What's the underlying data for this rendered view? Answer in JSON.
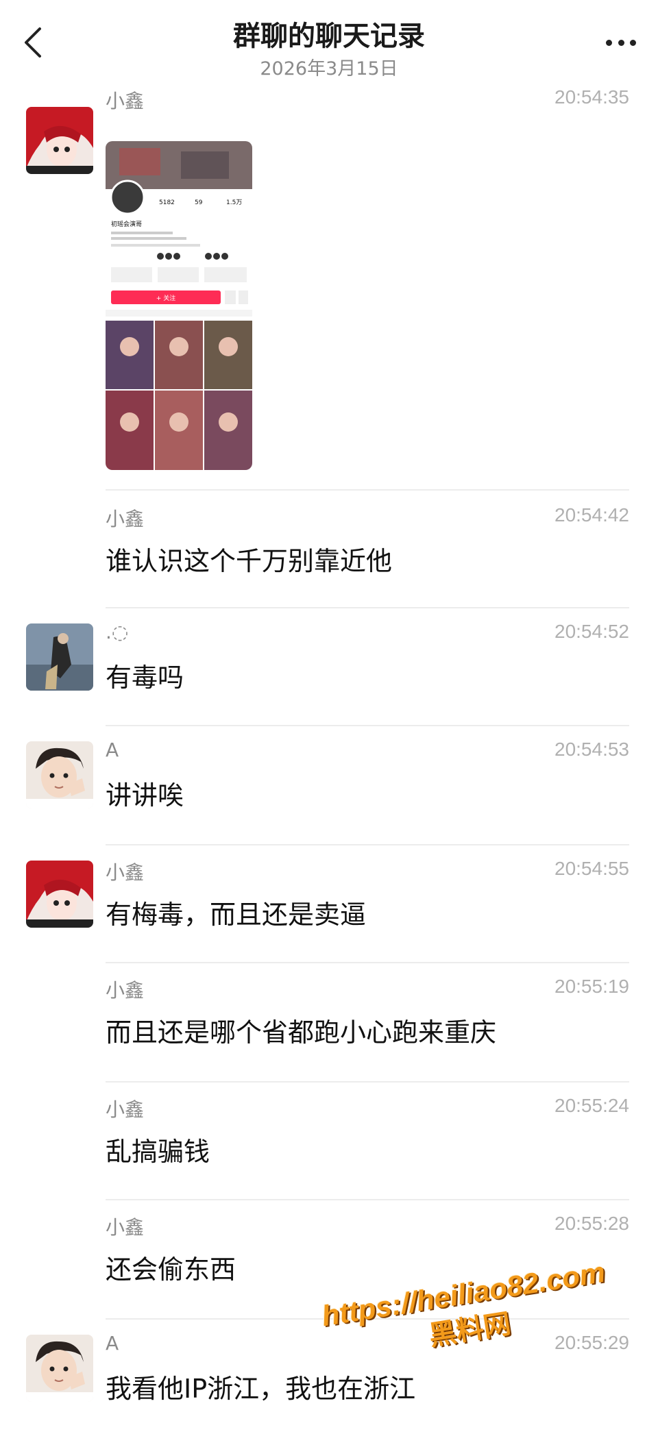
{
  "header": {
    "title": "群聊的聊天记录",
    "date": "2026年3月15日"
  },
  "screenshot_card": {
    "stats": [
      "5182",
      "59",
      "1.5万"
    ],
    "name": "初瑶会演哥",
    "follow_label": "+ 关注"
  },
  "messages": [
    {
      "sender": "小鑫",
      "time": "20:54:35",
      "text": "",
      "type": "image"
    },
    {
      "sender": "小鑫",
      "time": "20:54:42",
      "text": "谁认识这个千万别靠近他"
    },
    {
      "sender": ".◌",
      "time": "20:54:52",
      "text": "有毒吗"
    },
    {
      "sender": "A",
      "time": "20:54:53",
      "text": "讲讲唉"
    },
    {
      "sender": "小鑫",
      "time": "20:54:55",
      "text": "有梅毒，而且还是卖逼"
    },
    {
      "sender": "小鑫",
      "time": "20:55:19",
      "text": "而且还是哪个省都跑小心跑来重庆"
    },
    {
      "sender": "小鑫",
      "time": "20:55:24",
      "text": "乱搞骗钱"
    },
    {
      "sender": "小鑫",
      "time": "20:55:28",
      "text": "还会偷东西"
    },
    {
      "sender": "A",
      "time": "20:55:29",
      "text": "我看他IP浙江，我也在浙江"
    }
  ],
  "watermark": {
    "url": "https://heiliao82.com",
    "name": "黑料网"
  },
  "colors": {
    "accent": "#fe2c55",
    "watermark": "#f39a1a"
  }
}
